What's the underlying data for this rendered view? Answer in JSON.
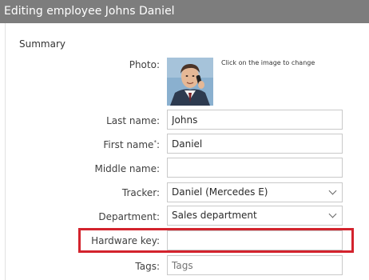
{
  "window": {
    "title": "Editing employee Johns Daniel"
  },
  "summary": {
    "section_title": "Summary",
    "photo": {
      "label": "Photo:",
      "hint": "Click on the image to change"
    },
    "last_name": {
      "label": "Last name:",
      "value": "Johns"
    },
    "first_name": {
      "label": "First name",
      "required_mark": "*",
      "colon": ":",
      "value": "Daniel"
    },
    "middle_name": {
      "label": "Middle name:",
      "value": ""
    },
    "tracker": {
      "label": "Tracker:",
      "value": "Daniel (Mercedes E)"
    },
    "department": {
      "label": "Department:",
      "value": "Sales department"
    },
    "hardware_key": {
      "label": "Hardware key:",
      "value": ""
    },
    "tags": {
      "label": "Tags:",
      "placeholder": "Tags"
    }
  },
  "colors": {
    "title_bar": "#7d7d7d",
    "highlight": "#d3232d"
  }
}
